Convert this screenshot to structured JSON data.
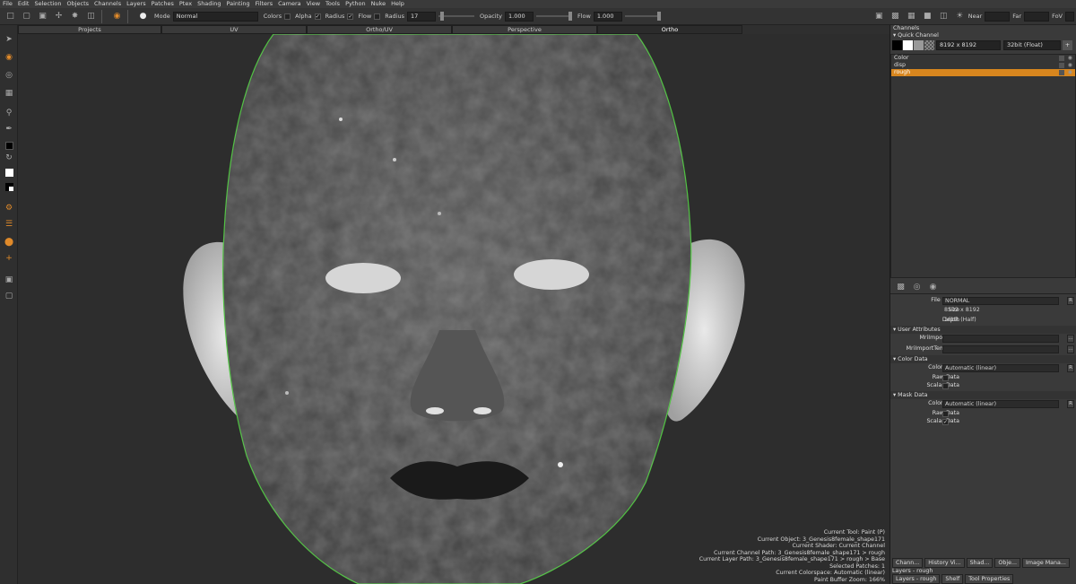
{
  "menu": [
    "File",
    "Edit",
    "Selection",
    "Objects",
    "Channels",
    "Layers",
    "Patches",
    "Ptex",
    "Shading",
    "Painting",
    "Filters",
    "Camera",
    "View",
    "Tools",
    "Python",
    "Nuke",
    "Help"
  ],
  "toolbar": {
    "mode_label": "Mode",
    "mode_value": "Normal",
    "colors_label": "Colors",
    "alpha_label": "Alpha",
    "radius_toggle_label": "Radius",
    "flow_toggle_label": "Flow",
    "radius_label": "Radius",
    "radius_value": "17",
    "opacity_label": "Opacity",
    "opacity_value": "1.000",
    "flow_label": "Flow",
    "flow_value": "1.000",
    "near_label": "Near",
    "far_label": "Far",
    "fov_label": "FoV"
  },
  "tabs": [
    "Projects",
    "UV",
    "Ortho/UV",
    "Perspective",
    "Ortho"
  ],
  "tab_active": 4,
  "status": [
    "Current Tool: Paint (P)",
    "Current Object: 3_Genesis8female_shape171",
    "Current Shader: Current Channel",
    "Current Channel Path: 3_Genesis8female_shape171 > rough",
    "Current Layer Path: 3_Genesis8female_shape171 > rough > Base",
    "Selected Patches: 1",
    "Current Colorspace: Automatic (linear)",
    "Paint Buffer Zoom: 166%"
  ],
  "channels_panel": {
    "title": "Channels",
    "quick_channel": "Quick Channel",
    "size_value": "8192 x 8192",
    "depth_value": "32bit (Float)",
    "items": [
      {
        "name": "Color",
        "selected": false
      },
      {
        "name": "disp",
        "selected": false
      },
      {
        "name": "rough",
        "selected": true
      }
    ]
  },
  "props": {
    "file_space_label": "File Space",
    "file_space_value": "NORMAL",
    "size_label": "Size",
    "size_value": "8192 x 8192",
    "depth_label": "Depth",
    "depth_value": "16bit (Half)",
    "user_attributes": "User Attributes",
    "mri_import_path": "MriImportPath",
    "mri_import_template": "MriImportTemplate",
    "color_data": "Color Data",
    "colorspace_label": "Colorspace",
    "colorspace_value": "Automatic (linear)",
    "raw_data": "Raw Data",
    "scalar_data": "Scalar Data",
    "mask_data": "Mask Data",
    "mask_colorspace_value": "Automatic (linear)",
    "reset_label": "R"
  },
  "bottom_tabs": [
    "Chann...",
    "History Vi...",
    "Shad...",
    "Obje...",
    "Image Mana..."
  ],
  "layers_title": "Layers - rough",
  "bottom_tabs2": [
    "Layers - rough",
    "Shelf",
    "Tool Properties"
  ],
  "colors": {
    "accent": "#d8861e",
    "outline": "#49c23a"
  }
}
